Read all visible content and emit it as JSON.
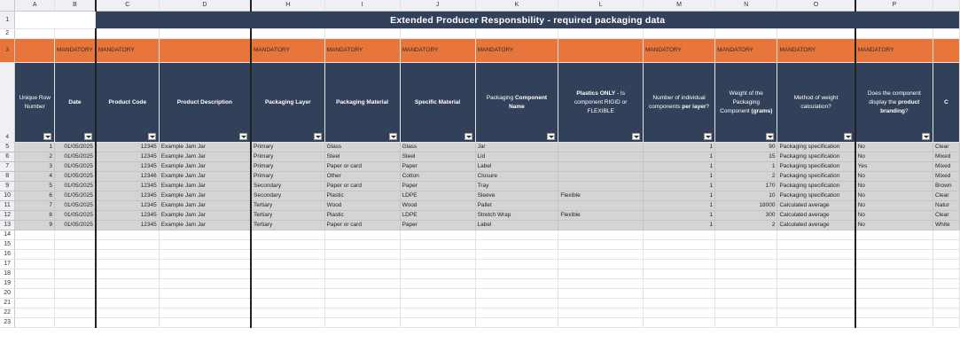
{
  "title": "Extended Producer Responsbility - required packaging data",
  "columns": [
    "A",
    "B",
    "C",
    "D",
    "H",
    "I",
    "J",
    "K",
    "L",
    "M",
    "N",
    "O",
    "P"
  ],
  "rows": [
    "1",
    "2",
    "3",
    "4",
    "5",
    "6",
    "7",
    "8",
    "9",
    "10",
    "11",
    "12",
    "13",
    "14",
    "15",
    "16",
    "17",
    "18",
    "19",
    "20",
    "21",
    "22",
    "23"
  ],
  "mandatory": "MANDATORY",
  "headers": {
    "unique_row": "Unique Row Number",
    "date": "Date",
    "product_code": "Product Code",
    "product_desc": "Product Description",
    "packaging_layer": "Packaging Layer",
    "packaging_material": "Packaging Material",
    "specific_material": "Specific Material",
    "component_name_pre": "Packaging ",
    "component_name_bold": "Component Name",
    "plastics_bold": "Plastics ONLY",
    "plastics_rest": " - Is component RIGID or FLEXIBLE",
    "num_components_pre": "Number of individual components ",
    "num_components_bold": "per layer",
    "num_components_post": "?",
    "weight_pre": "Weight of the Packaging Component ",
    "weight_bold": "(grams)",
    "weight_method": "Method of weight calculation?",
    "branding_pre": "Does the component display the ",
    "branding_bold": "product branding",
    "branding_post": "?",
    "next_col_fragment": "C"
  },
  "data": [
    {
      "n": "1",
      "date": "01/05/2025",
      "code": "12345",
      "desc": "Example Jam Jar",
      "layer": "Primary",
      "material": "Glass",
      "specific": "Glass",
      "component": "Jar",
      "plastic": "",
      "count": "1",
      "weight": "90",
      "method": "Packaging specification",
      "branding": "No",
      "next": "Clear"
    },
    {
      "n": "2",
      "date": "01/05/2025",
      "code": "12345",
      "desc": "Example Jam Jar",
      "layer": "Primary",
      "material": "Steel",
      "specific": "Steel",
      "component": "Lid",
      "plastic": "",
      "count": "1",
      "weight": "15",
      "method": "Packaging specification",
      "branding": "No",
      "next": "Mixed"
    },
    {
      "n": "3",
      "date": "01/05/2025",
      "code": "12345",
      "desc": "Example Jam Jar",
      "layer": "Primary",
      "material": "Paper or card",
      "specific": "Paper",
      "component": "Label",
      "plastic": "",
      "count": "1",
      "weight": "1",
      "method": "Packaging specification",
      "branding": "Yes",
      "next": "Mixed"
    },
    {
      "n": "4",
      "date": "01/05/2025",
      "code": "12346",
      "desc": "Example Jam Jar",
      "layer": "Primary",
      "material": "Other",
      "specific": "Cotton",
      "component": "Closure",
      "plastic": "",
      "count": "1",
      "weight": "2",
      "method": "Packaging specification",
      "branding": "No",
      "next": "Mixed"
    },
    {
      "n": "5",
      "date": "01/05/2025",
      "code": "12345",
      "desc": "Example Jam Jar",
      "layer": "Secondary",
      "material": "Paper or card",
      "specific": "Paper",
      "component": "Tray",
      "plastic": "",
      "count": "1",
      "weight": "170",
      "method": "Packaging specification",
      "branding": "No",
      "next": "Brown"
    },
    {
      "n": "6",
      "date": "01/05/2025",
      "code": "12345",
      "desc": "Example Jam Jar",
      "layer": "Secondary",
      "material": "Plastic",
      "specific": "LDPE",
      "component": "Sleeve",
      "plastic": "Flexible",
      "count": "1",
      "weight": "10",
      "method": "Packaging specification",
      "branding": "No",
      "next": "Clear"
    },
    {
      "n": "7",
      "date": "01/05/2025",
      "code": "12345",
      "desc": "Example Jam Jar",
      "layer": "Tertiary",
      "material": "Wood",
      "specific": "Wood",
      "component": "Pallet",
      "plastic": "",
      "count": "1",
      "weight": "18000",
      "method": "Calculated average",
      "branding": "No",
      "next": "Natur"
    },
    {
      "n": "8",
      "date": "01/05/2025",
      "code": "12345",
      "desc": "Example Jam Jar",
      "layer": "Tertiary",
      "material": "Plastic",
      "specific": "LDPE",
      "component": "Stretch Wrap",
      "plastic": "Flexible",
      "count": "1",
      "weight": "300",
      "method": "Calculated average",
      "branding": "No",
      "next": "Clear"
    },
    {
      "n": "9",
      "date": "01/05/2025",
      "code": "12345",
      "desc": "Example Jam Jar",
      "layer": "Tertiary",
      "material": "Paper or card",
      "specific": "Paper",
      "component": "Label",
      "plastic": "",
      "count": "1",
      "weight": "2",
      "method": "Calculated average",
      "branding": "No",
      "next": "White"
    }
  ],
  "colors": {
    "navy": "#33405a",
    "orange": "#e8763a",
    "data_grey": "#d4d4d4"
  }
}
